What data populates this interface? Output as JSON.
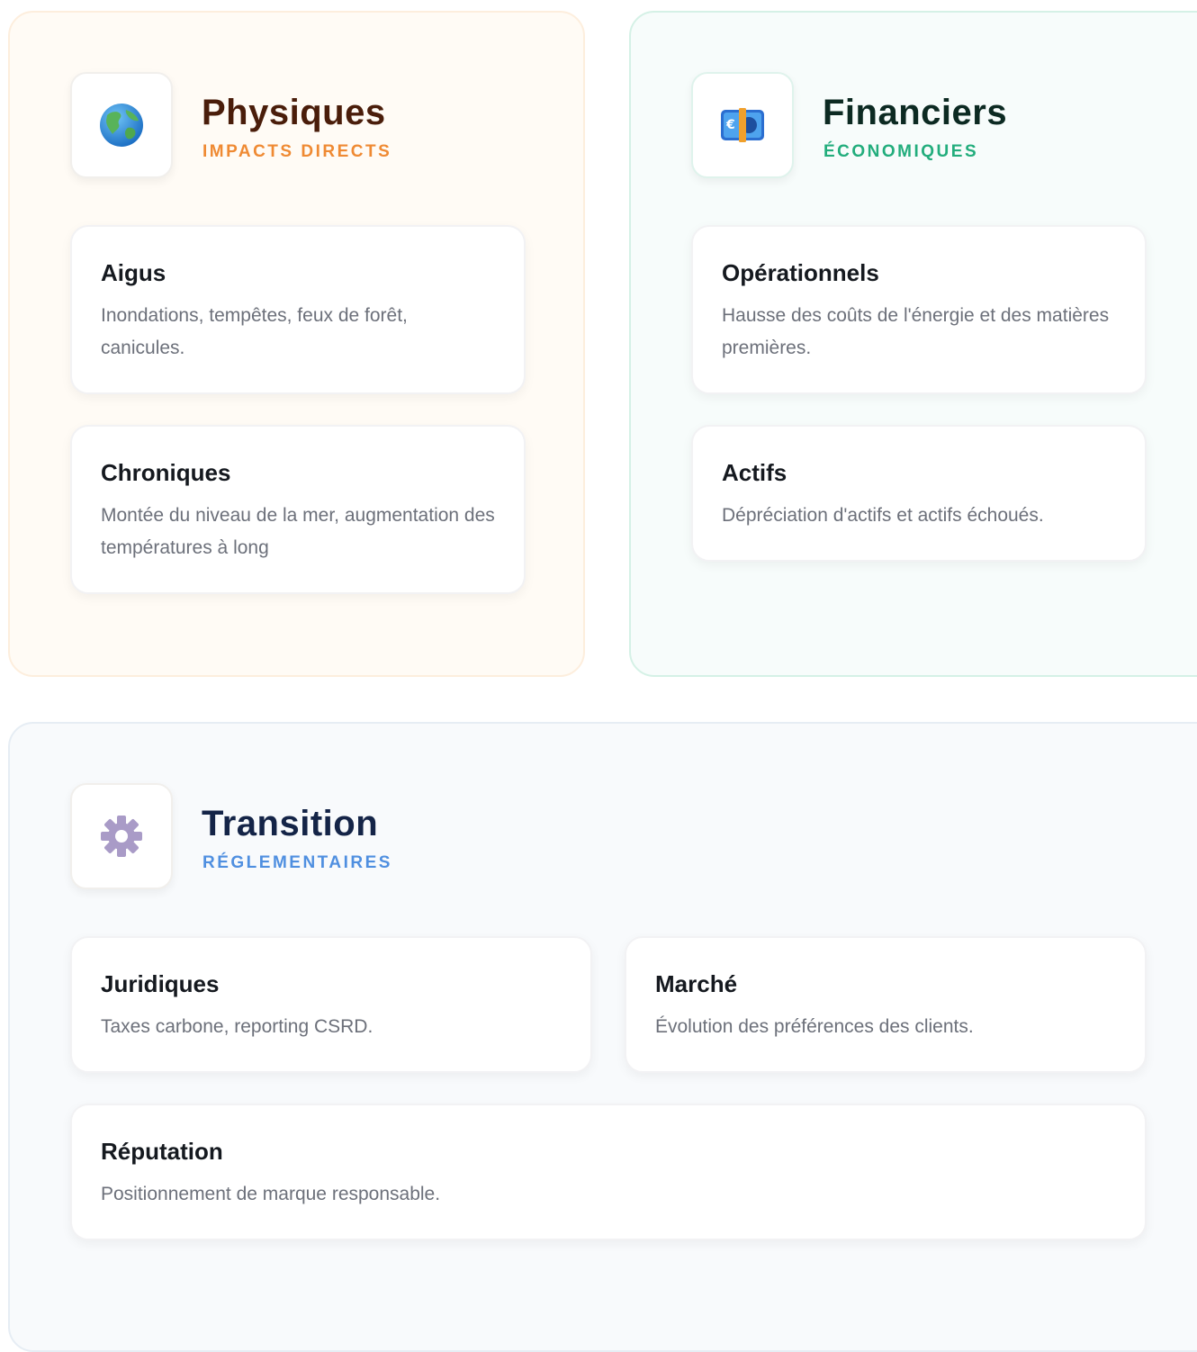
{
  "physiques": {
    "title": "Physiques",
    "subtitle": "IMPACTS DIRECTS",
    "icon": "globe-icon",
    "cards": [
      {
        "title": "Aigus",
        "desc": "Inondations, tempêtes, feux de forêt, canicules."
      },
      {
        "title": "Chroniques",
        "desc": "Montée du niveau de la mer, augmentation des températures à long"
      }
    ]
  },
  "financiers": {
    "title": "Financiers",
    "subtitle": "ÉCONOMIQUES",
    "icon": "euro-banknote-icon",
    "cards": [
      {
        "title": "Opérationnels",
        "desc": "Hausse des coûts de l'énergie et des matières premières."
      },
      {
        "title": "Actifs",
        "desc": "Dépréciation d'actifs et actifs échoués."
      }
    ]
  },
  "transition": {
    "title": "Transition",
    "subtitle": "RÉGLEMENTAIRES",
    "icon": "gear-icon",
    "cards": [
      {
        "title": "Juridiques",
        "desc": "Taxes carbone, reporting CSRD."
      },
      {
        "title": "Marché",
        "desc": "Évolution des préférences des clients."
      },
      {
        "title": "Réputation",
        "desc": "Positionnement de marque responsable."
      }
    ]
  }
}
